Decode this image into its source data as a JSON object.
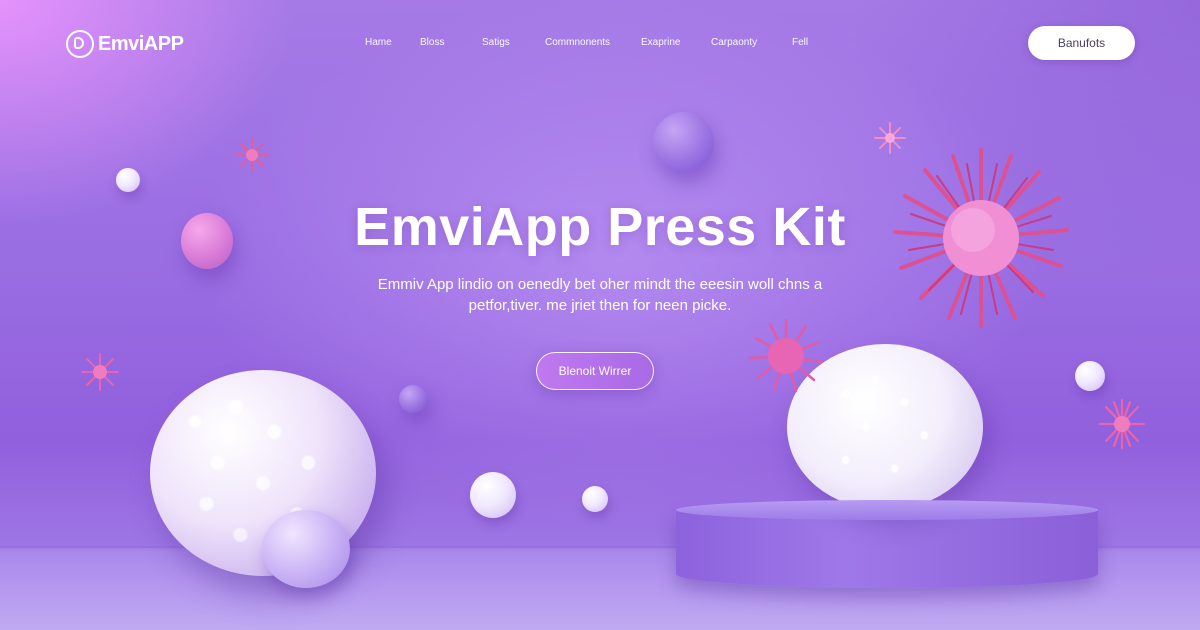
{
  "brand": {
    "name": "EmviAPP"
  },
  "nav": {
    "items": [
      "Hame",
      "Bloss",
      "Satigs",
      "Commnonents",
      "Exaprine",
      "Carpaonty",
      "Fell"
    ],
    "button_label": "Banufots"
  },
  "hero": {
    "title": "EmviApp Press Kit",
    "subtitle_line1": "Emmiv App lindio on oenedly bet oher mindt the eeesin woll chns a",
    "subtitle_line2": "petfor,tiver. me jriet then for neen picke.",
    "cta_label": "Blenoit Wirrer"
  },
  "colors": {
    "background": "#9a6ee3",
    "accent_pink": "#e25aa8",
    "button_bg": "#ffffff",
    "cta_gradient_start": "#c078f0",
    "cta_gradient_end": "#a86ae6"
  },
  "icons": {
    "logo": "logo-mark-icon"
  }
}
